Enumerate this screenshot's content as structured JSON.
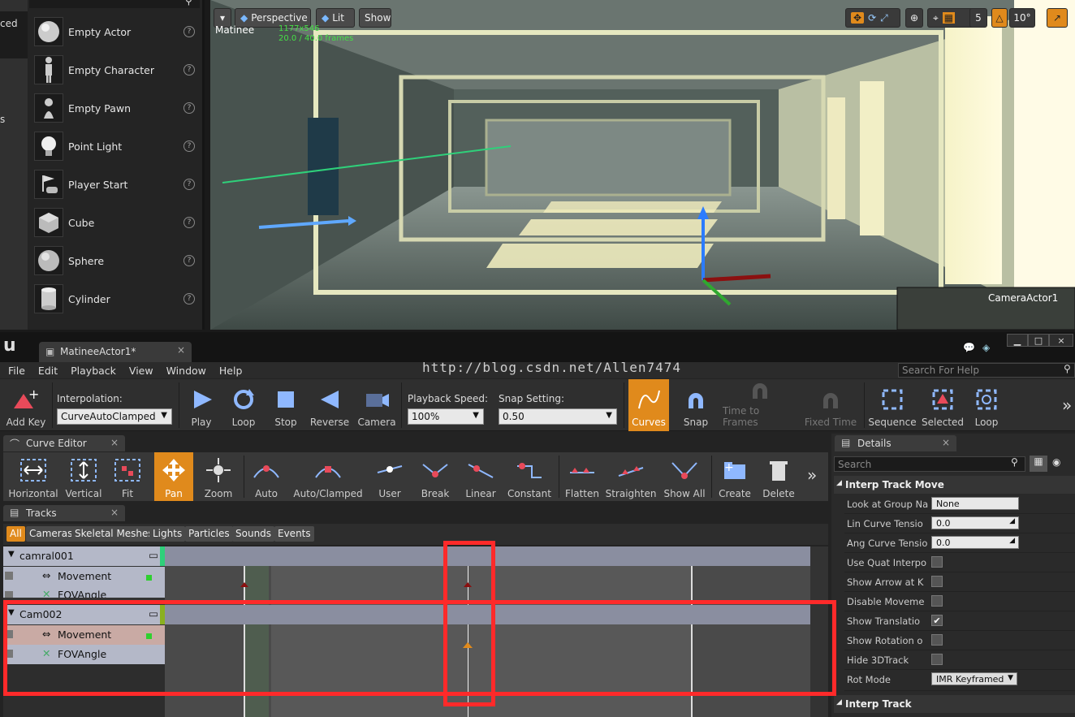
{
  "place_panel": {
    "left_tabs": [
      "ced",
      "s"
    ],
    "items": [
      {
        "label": "Empty Actor",
        "icon": "sphere-icon"
      },
      {
        "label": "Empty Character",
        "icon": "figure-icon"
      },
      {
        "label": "Empty Pawn",
        "icon": "pawn-icon"
      },
      {
        "label": "Point Light",
        "icon": "lightbulb-icon"
      },
      {
        "label": "Player Start",
        "icon": "flag-controller-icon"
      },
      {
        "label": "Cube",
        "icon": "cube-icon"
      },
      {
        "label": "Sphere",
        "icon": "sphere-icon"
      },
      {
        "label": "Cylinder",
        "icon": "cylinder-icon"
      }
    ],
    "help_glyph": "?"
  },
  "viewport": {
    "view_mode": "Perspective",
    "lighting": "Lit",
    "show": "Show",
    "overlay_title": "Matinee",
    "overlay_res": "1177x546",
    "overlay_frames": "20.0 / 40.0 frames",
    "grid_value": "5",
    "angle_value": "10°",
    "camera_label": "CameraActor1"
  },
  "window": {
    "doc_tab": "MatineeActor1*",
    "close_glyph": "×",
    "min_glyph": "▁",
    "max_glyph": "□"
  },
  "menu": [
    "File",
    "Edit",
    "Playback",
    "View",
    "Window",
    "Help"
  ],
  "watermark": "http://blog.csdn.net/Allen7474",
  "help_search_placeholder": "Search For Help",
  "toolbar": {
    "add_key": "Add Key",
    "interpolation_label": "Interpolation:",
    "interpolation_value": "CurveAutoClamped",
    "play": "Play",
    "loop": "Loop",
    "stop": "Stop",
    "reverse": "Reverse",
    "camera": "Camera",
    "playback_speed_label": "Playback Speed:",
    "playback_speed_value": "100%",
    "snap_setting_label": "Snap Setting:",
    "snap_setting_value": "0.50",
    "curves": "Curves",
    "snap": "Snap",
    "time_to_frames": "Time to Frames",
    "fixed_time": "Fixed Time",
    "sequence": "Sequence",
    "selected": "Selected",
    "loop2": "Loop",
    "more": "»"
  },
  "curve_editor": {
    "tab": "Curve Editor",
    "buttons": [
      "Horizontal",
      "Vertical",
      "Fit",
      "Pan",
      "Zoom",
      "Auto",
      "Auto/Clamped",
      "User",
      "Break",
      "Linear",
      "Constant",
      "Flatten",
      "Straighten",
      "Show All",
      "Create",
      "Delete"
    ],
    "more": "»"
  },
  "tracks": {
    "tab": "Tracks",
    "filters": [
      "All",
      "Cameras",
      "Skeletal Meshes",
      "Lights",
      "Particles",
      "Sounds",
      "Events"
    ],
    "groups": [
      {
        "name": "camral001",
        "tracks": [
          "Movement",
          "FOVAngle"
        ]
      },
      {
        "name": "Cam002",
        "tracks": [
          "Movement",
          "FOVAngle"
        ]
      }
    ]
  },
  "details": {
    "tab": "Details",
    "search_placeholder": "Search",
    "section1": "Interp Track Move",
    "rows": [
      {
        "label": "Look at Group Na",
        "value": "None",
        "kind": "text"
      },
      {
        "label": "Lin Curve Tensio",
        "value": "0.0",
        "kind": "text"
      },
      {
        "label": "Ang Curve Tensio",
        "value": "0.0",
        "kind": "text"
      },
      {
        "label": "Use Quat Interpo",
        "value": "",
        "kind": "check"
      },
      {
        "label": "Show Arrow at K",
        "value": "",
        "kind": "check"
      },
      {
        "label": "Disable Moveme",
        "value": "",
        "kind": "check"
      },
      {
        "label": "Show Translatio",
        "value": "✔",
        "kind": "check"
      },
      {
        "label": "Show Rotation o",
        "value": "",
        "kind": "check"
      },
      {
        "label": "Hide 3DTrack",
        "value": "",
        "kind": "check"
      },
      {
        "label": "Rot Mode",
        "value": "IMR Keyframed",
        "kind": "dropdown"
      }
    ],
    "section2": "Interp Track"
  },
  "colors": {
    "accent_orange": "#e08a1c",
    "annotation_red": "#ff2a2a",
    "group_bar": "#8a8ea0",
    "track_label_bg": "#b4b8c8"
  }
}
